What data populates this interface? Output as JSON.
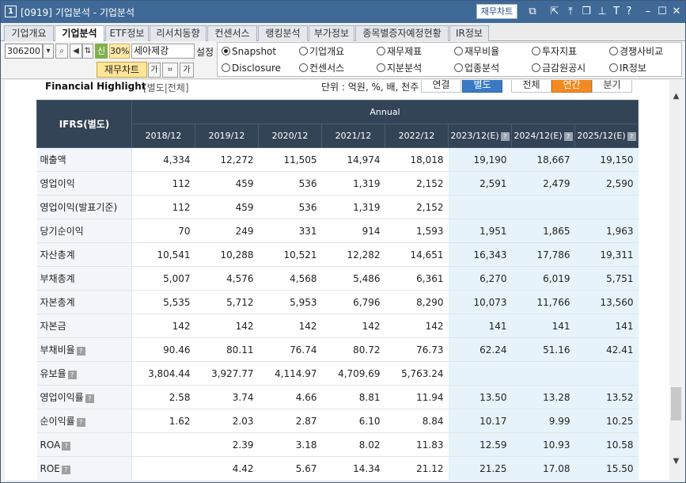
{
  "window": {
    "number": "1",
    "title": "[0919] 기업분석 - 기업분석",
    "chart_button": "재무차트"
  },
  "tabs": [
    "기업개요",
    "기업분석",
    "ETF정보",
    "리서치동향",
    "컨센서스",
    "랭킹분석",
    "부가정보",
    "종목별증자예정현황",
    "IR정보"
  ],
  "toolbar": {
    "code": "306200",
    "new_badge": "신",
    "pct_badge": "30%",
    "company_name": "세아제강",
    "settings_label": "설정",
    "fin_chart_label": "재무차트"
  },
  "radios": {
    "row1": [
      "Snapshot",
      "기업개요",
      "재무제표",
      "재무비율",
      "투자지표",
      "경쟁사비교"
    ],
    "row2": [
      "Disclosure",
      "컨센서스",
      "지분분석",
      "업종분석",
      "금감원공시",
      "IR정보"
    ],
    "selected": "Snapshot"
  },
  "highlight": {
    "title": "Financial Highlight",
    "subtitle": "[별도|전체]",
    "unit_label": "단위 : 억원, %, 배, 천주",
    "buttons": [
      "연결",
      "별도",
      "전체",
      "연간",
      "분기"
    ]
  },
  "table": {
    "corner_label": "IFRS(별도)",
    "group_label": "Annual",
    "columns": [
      "2018/12",
      "2019/12",
      "2020/12",
      "2021/12",
      "2022/12",
      "2023/12(E)",
      "2024/12(E)",
      "2025/12(E)"
    ],
    "rows": [
      {
        "label": "매출액",
        "help": false,
        "values": [
          "4,334",
          "12,272",
          "11,505",
          "14,974",
          "18,018",
          "19,190",
          "18,667",
          "19,150"
        ]
      },
      {
        "label": "영업이익",
        "help": false,
        "values": [
          "112",
          "459",
          "536",
          "1,319",
          "2,152",
          "2,591",
          "2,479",
          "2,590"
        ]
      },
      {
        "label": "영업이익(발표기준)",
        "help": false,
        "values": [
          "112",
          "459",
          "536",
          "1,319",
          "2,152",
          "",
          "",
          ""
        ]
      },
      {
        "label": "당기순이익",
        "help": false,
        "values": [
          "70",
          "249",
          "331",
          "914",
          "1,593",
          "1,951",
          "1,865",
          "1,963"
        ]
      },
      {
        "label": "자산총계",
        "help": false,
        "values": [
          "10,541",
          "10,288",
          "10,521",
          "12,282",
          "14,651",
          "16,343",
          "17,786",
          "19,311"
        ]
      },
      {
        "label": "부채총계",
        "help": false,
        "values": [
          "5,007",
          "4,576",
          "4,568",
          "5,486",
          "6,361",
          "6,270",
          "6,019",
          "5,751"
        ]
      },
      {
        "label": "자본총계",
        "help": false,
        "values": [
          "5,535",
          "5,712",
          "5,953",
          "6,796",
          "8,290",
          "10,073",
          "11,766",
          "13,560"
        ]
      },
      {
        "label": "자본금",
        "help": false,
        "values": [
          "142",
          "142",
          "142",
          "142",
          "142",
          "141",
          "141",
          "141"
        ]
      },
      {
        "label": "부채비율",
        "help": true,
        "values": [
          "90.46",
          "80.11",
          "76.74",
          "80.72",
          "76.73",
          "62.24",
          "51.16",
          "42.41"
        ]
      },
      {
        "label": "유보율",
        "help": true,
        "values": [
          "3,804.44",
          "3,927.77",
          "4,114.97",
          "4,709.69",
          "5,763.24",
          "",
          "",
          ""
        ]
      },
      {
        "label": "영업이익률",
        "help": true,
        "values": [
          "2.58",
          "3.74",
          "4.66",
          "8.81",
          "11.94",
          "13.50",
          "13.28",
          "13.52"
        ]
      },
      {
        "label": "순이익률",
        "help": true,
        "values": [
          "1.62",
          "2.03",
          "2.87",
          "6.10",
          "8.84",
          "10.17",
          "9.99",
          "10.25"
        ]
      },
      {
        "label": "ROA",
        "help": true,
        "values": [
          "",
          "2.39",
          "3.18",
          "8.02",
          "11.83",
          "12.59",
          "10.93",
          "10.58"
        ]
      },
      {
        "label": "ROE",
        "help": true,
        "values": [
          "",
          "4.42",
          "5.67",
          "14.34",
          "21.12",
          "21.25",
          "17.08",
          "15.50"
        ]
      }
    ]
  }
}
